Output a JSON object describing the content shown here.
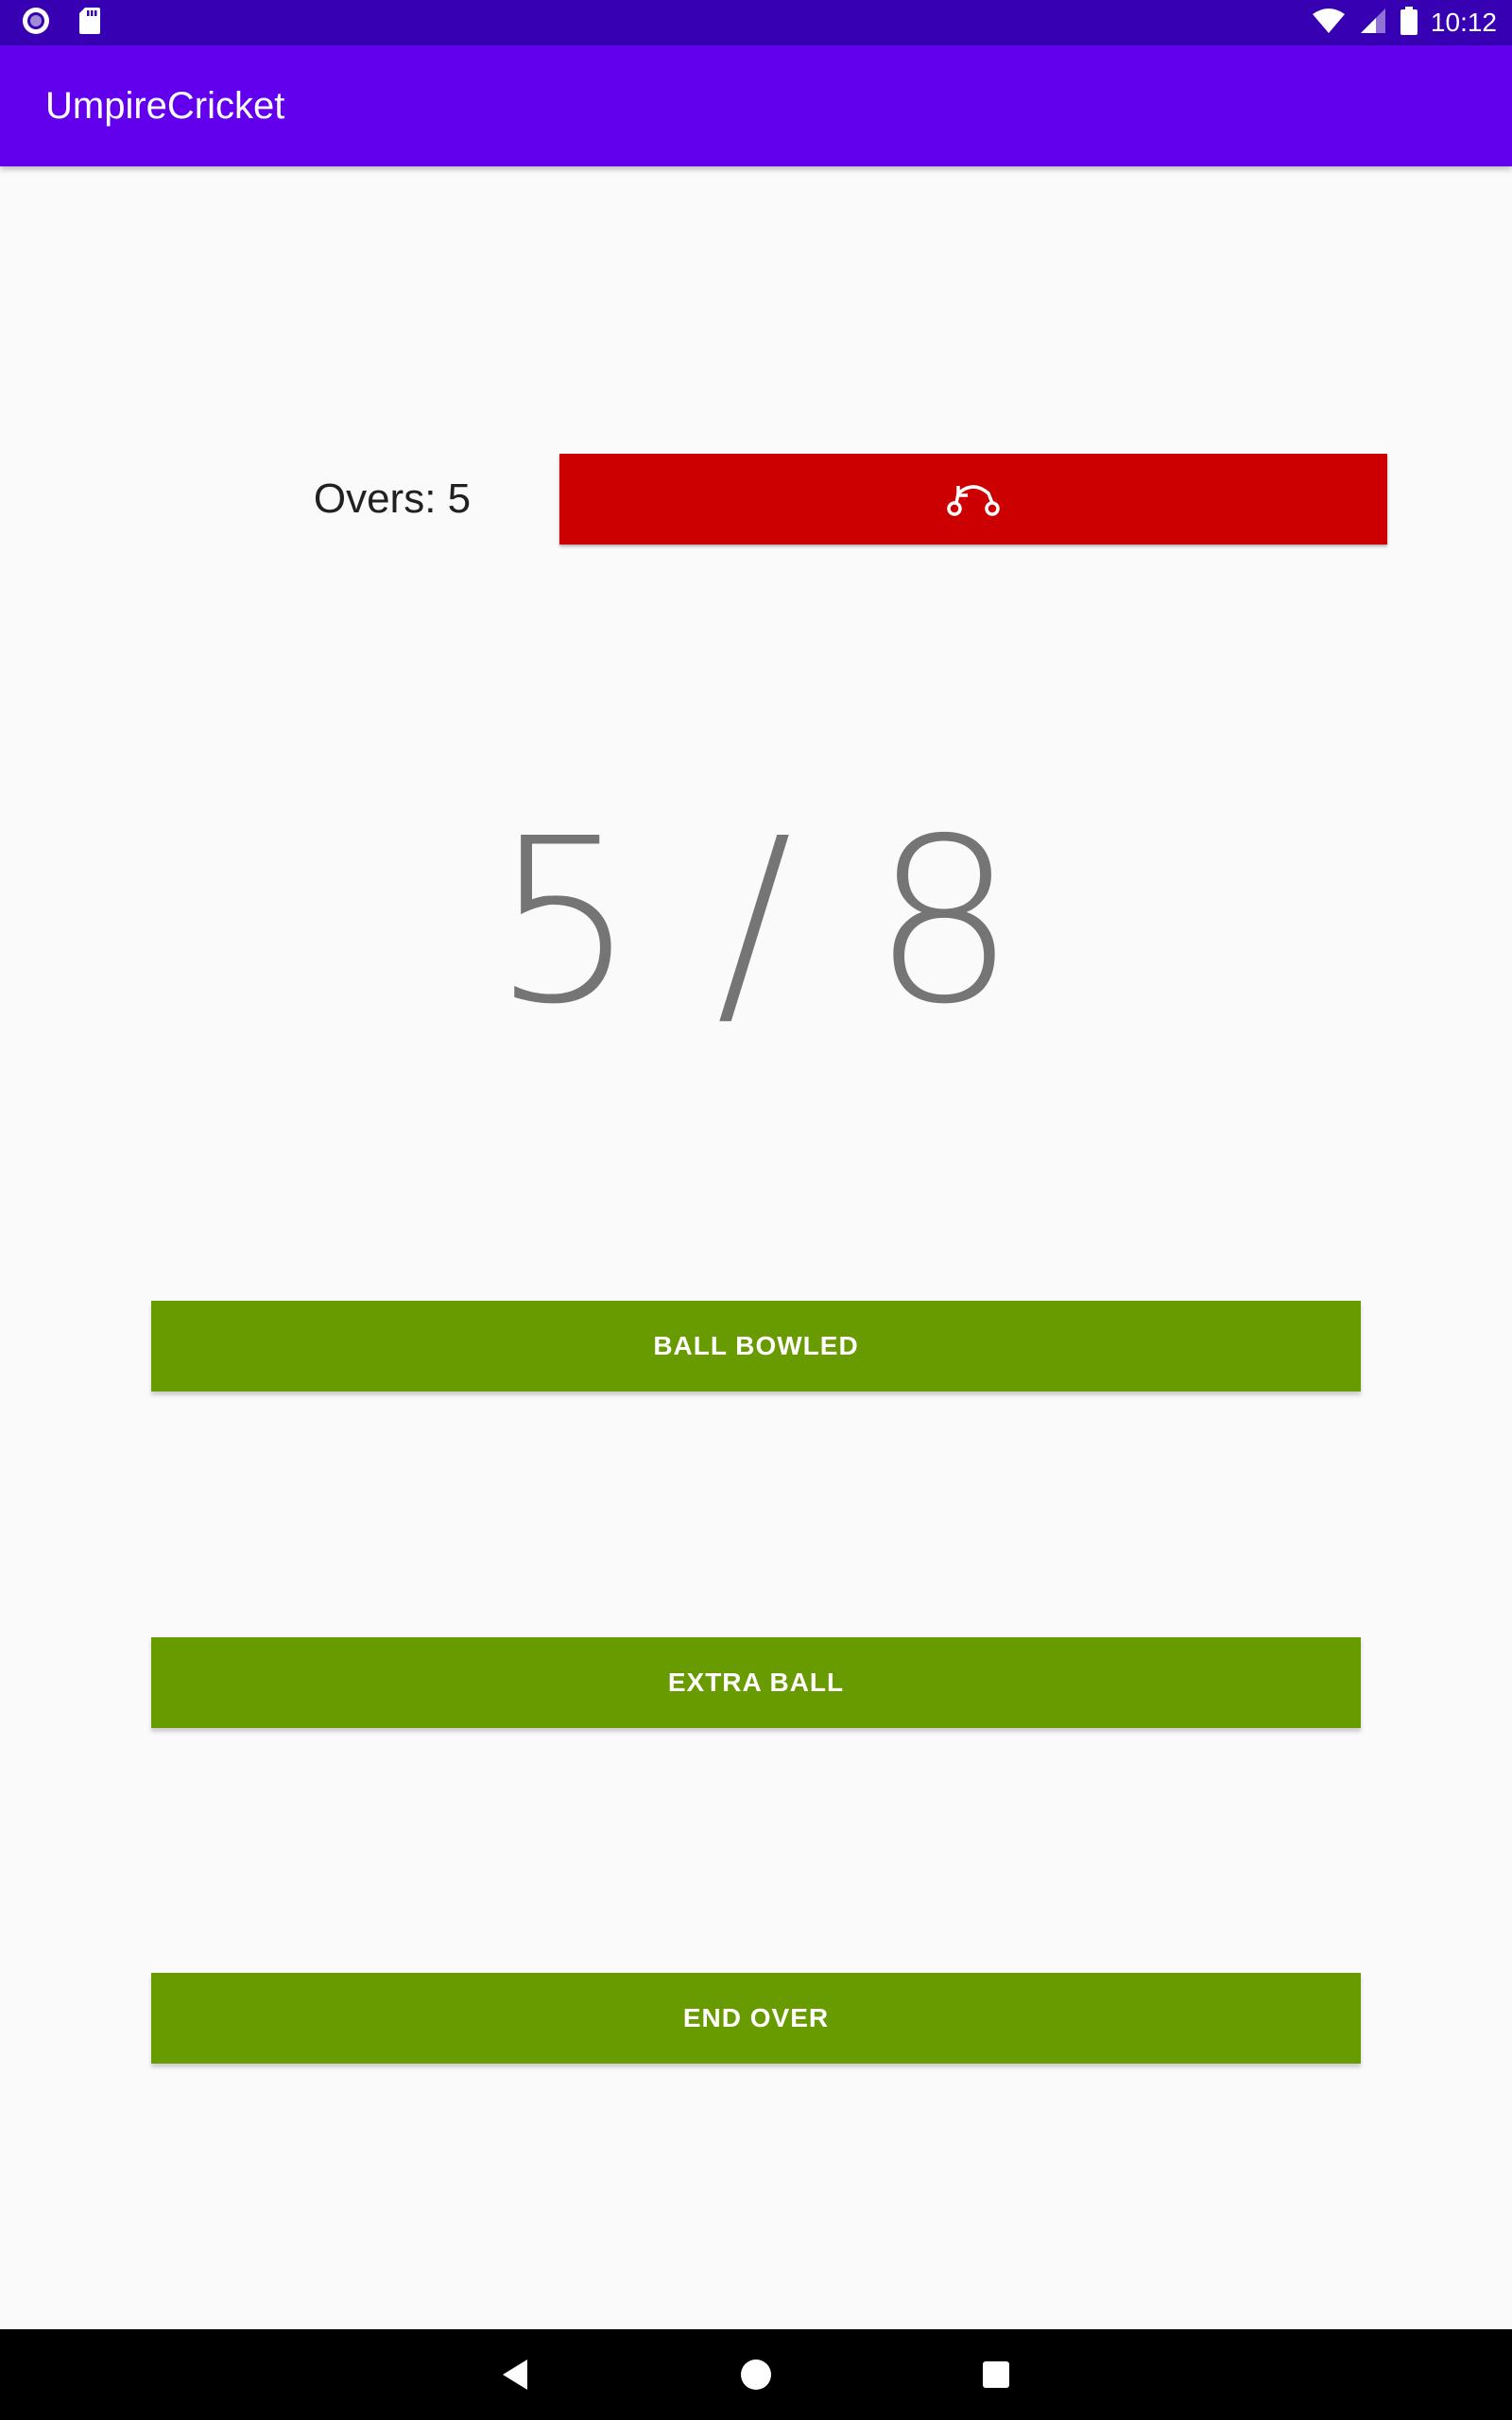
{
  "status_bar": {
    "time": "10:12",
    "left_icons": [
      "notification-app-icon",
      "sd-card-icon"
    ],
    "right_icons": [
      "wifi-icon",
      "cell-signal-icon",
      "battery-icon"
    ]
  },
  "app_bar": {
    "title": "UmpireCricket",
    "color": "#6200ee"
  },
  "overs": {
    "label": "Overs: 5"
  },
  "undo_button": {
    "icon": "undo-route-icon",
    "color": "#cc0000"
  },
  "score": {
    "text": "5 / 8"
  },
  "actions": {
    "ball_bowled": "BALL BOWLED",
    "extra_ball": "EXTRA BALL",
    "end_over": "END OVER",
    "color": "#689b00"
  },
  "nav_bar": {
    "icons": [
      "back-icon",
      "home-icon",
      "recents-icon"
    ]
  }
}
